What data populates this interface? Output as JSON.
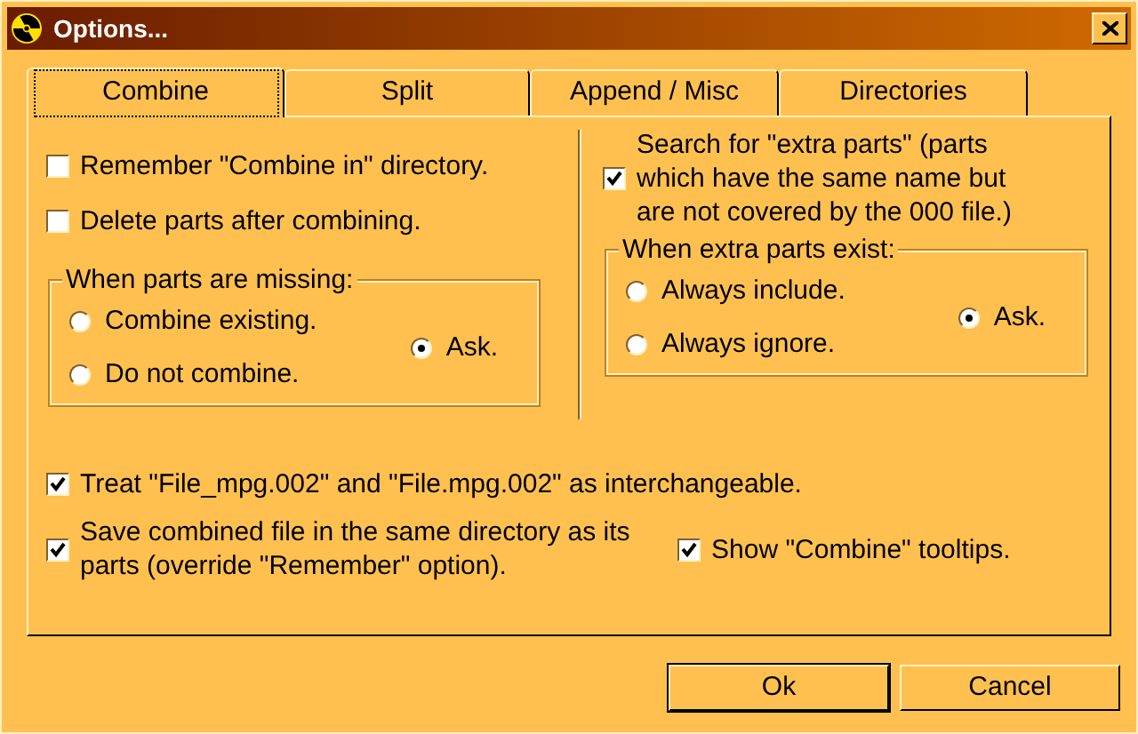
{
  "window": {
    "title": "Options..."
  },
  "tabs": [
    {
      "label": "Combine",
      "selected": true
    },
    {
      "label": "Split",
      "selected": false
    },
    {
      "label": "Append / Misc",
      "selected": false
    },
    {
      "label": "Directories",
      "selected": false
    }
  ],
  "left": {
    "checkboxes": [
      {
        "label": "Remember \"Combine in\" directory.",
        "checked": false
      },
      {
        "label": "Delete parts after combining.",
        "checked": false
      }
    ],
    "group": {
      "title": "When parts are missing:",
      "options": [
        {
          "label": "Combine existing.",
          "selected": false
        },
        {
          "label": "Do not combine.",
          "selected": false
        },
        {
          "label": "Ask.",
          "selected": true
        }
      ]
    }
  },
  "right": {
    "checkboxes": [
      {
        "label": "Search for \"extra parts\" (parts which have the same name but are not covered by the 000 file.)",
        "checked": true
      }
    ],
    "group": {
      "title": "When extra parts exist:",
      "options": [
        {
          "label": "Always include.",
          "selected": false
        },
        {
          "label": "Always ignore.",
          "selected": false
        },
        {
          "label": "Ask.",
          "selected": true
        }
      ]
    }
  },
  "bottom_checkboxes": [
    {
      "label": "Treat \"File_mpg.002\" and \"File.mpg.002\" as interchangeable.",
      "checked": true
    },
    {
      "label": "Save combined file in the same directory as its parts (override \"Remember\" option).",
      "checked": true
    },
    {
      "label": "Show \"Combine\" tooltips.",
      "checked": true
    }
  ],
  "buttons": [
    "Ok",
    "Cancel"
  ]
}
